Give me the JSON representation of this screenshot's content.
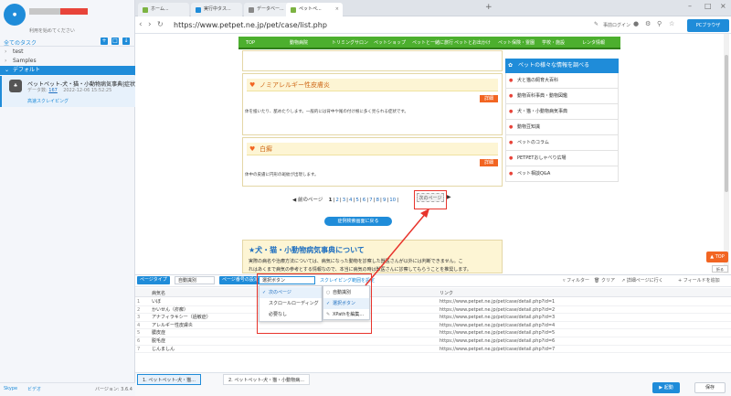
{
  "left": {
    "account_sub": "利用を始めてください",
    "tasks_header": "全てのタスク",
    "folders": [
      {
        "label": "test"
      },
      {
        "label": "Samples"
      },
      {
        "label": "デフォルト"
      }
    ],
    "task": {
      "title": "ペットペット-犬・猫・小動物病気事典|症状...",
      "meta_label": "データ数:",
      "meta_count": "167",
      "date": "2022-12-06 15:52:25",
      "link": "高速スクレイピング"
    },
    "footer": {
      "skype": "Skype",
      "mail": "ビデオ",
      "version": "バージョン: 3.6.4"
    }
  },
  "browser": {
    "tabs": [
      {
        "label": "ホーム..."
      },
      {
        "label": "実行中タス..."
      },
      {
        "label": "データベー..."
      },
      {
        "label": "ペットペ..."
      }
    ],
    "url": "https://www.petpet.ne.jp/pet/case/list.php",
    "login": "事前ログイン",
    "pc_browser": "PCブラウザ"
  },
  "site": {
    "nav": [
      "TOP",
      "動物病院",
      "トリミングサロン",
      "ペットショップ",
      "ペットと一緒に旅行",
      "ペットとお出かけ",
      "ペット保険・霊園",
      "学校・施設",
      "レンタ情報"
    ],
    "card1": {
      "title": "ノミアレルギー性皮膚炎",
      "btn": "詳細",
      "text": "体を掻いたり、舐めたりします。一般的には背中や尾の付け根に多く見られる症状です。"
    },
    "card2": {
      "title": "白癬",
      "btn": "詳細",
      "text": "体中の皮膚に円形の斑紋が出現します。"
    },
    "pager": {
      "prev": "◀ 前のページ",
      "pages": [
        "1",
        "2",
        "3",
        "4",
        "5",
        "6",
        "7",
        "8",
        "9",
        "10"
      ],
      "next": "次のページ",
      "next_arrow": "▶"
    },
    "back_button": "症例検索画面に戻る",
    "dict": {
      "title": "★犬・猫・小動物病気事典について",
      "body1": "実際の病名や治療方法については、病気になった動物を診察した獣医さんが以外には判断できません。こ",
      "body2": "れはあくまで病気の参考とする情報なので、本当に病気の時は獣医さんに診察してもらうことを推奨します。"
    },
    "sidebar": {
      "head": "ペットの様々な情報を調べる",
      "items": [
        "犬と猫の飼育大百科",
        "動物百科事典・動物図鑑",
        "犬・猫・小動物病気事典",
        "動物豆知識",
        "ペットのコラム",
        "PETPETおしゃべり広場",
        "ペット相談Q&A"
      ]
    },
    "top_btn": "▲ TOP",
    "collapse": "折る"
  },
  "toolbar": {
    "page_type": "ページタイプ",
    "page_type_value": "自動識別",
    "page_setting": "ページ番号の設定",
    "page_setting_value": "選択ボタン",
    "scroll_range": "スクレイピング範囲を設定",
    "filter": "フィルター",
    "clear": "クリア",
    "detail": "詳細ページに行く",
    "add_field": "フィールドを追加"
  },
  "dropdown1": {
    "items": [
      "次のページ",
      "スクロールローディング",
      "必要なし"
    ]
  },
  "dropdown2": {
    "items": [
      "自動識別",
      "選択ボタン",
      "XPathを編集..."
    ]
  },
  "table": {
    "headers": [
      "病気名",
      "リンク"
    ],
    "rows": [
      {
        "n": "1",
        "name": "いぼ",
        "link": "https://www.petpet.ne.jp/pet/case/detail.php?id=1"
      },
      {
        "n": "2",
        "name": "かいせん（疥癬）",
        "link": "https://www.petpet.ne.jp/pet/case/detail.php?id=2"
      },
      {
        "n": "3",
        "name": "アナフィラキシー（過敏症）",
        "link": "https://www.petpet.ne.jp/pet/case/detail.php?id=3"
      },
      {
        "n": "4",
        "name": "アレルギー性皮膚炎",
        "link": "https://www.petpet.ne.jp/pet/case/detail.php?id=4"
      },
      {
        "n": "5",
        "name": "膿皮症",
        "link": "https://www.petpet.ne.jp/pet/case/detail.php?id=5"
      },
      {
        "n": "6",
        "name": "脱毛症",
        "link": "https://www.petpet.ne.jp/pet/case/detail.php?id=6"
      },
      {
        "n": "7",
        "name": "じんましん",
        "link": "https://www.petpet.ne.jp/pet/case/detail.php?id=7"
      }
    ]
  },
  "bottom": {
    "tab1": "1. ペットペット-犬・猫...",
    "tab2": "2. ペットペット-犬・猫・小動物病...",
    "run": "▶ 起動",
    "save": "保存"
  }
}
